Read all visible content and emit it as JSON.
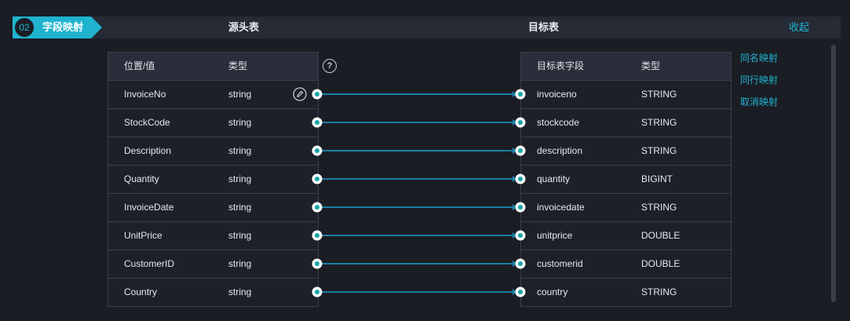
{
  "header": {
    "step_number": "02",
    "step_title": "字段映射",
    "source_title": "源头表",
    "target_title": "目标表",
    "collapse_label": "收起"
  },
  "source": {
    "columns": [
      "位置/值",
      "类型"
    ],
    "rows": [
      {
        "name": "InvoiceNo",
        "type": "string"
      },
      {
        "name": "StockCode",
        "type": "string"
      },
      {
        "name": "Description",
        "type": "string"
      },
      {
        "name": "Quantity",
        "type": "string"
      },
      {
        "name": "InvoiceDate",
        "type": "string"
      },
      {
        "name": "UnitPrice",
        "type": "string"
      },
      {
        "name": "CustomerID",
        "type": "string"
      },
      {
        "name": "Country",
        "type": "string"
      }
    ]
  },
  "target": {
    "columns": [
      "目标表字段",
      "类型"
    ],
    "rows": [
      {
        "name": "invoiceno",
        "type": "STRING"
      },
      {
        "name": "stockcode",
        "type": "STRING"
      },
      {
        "name": "description",
        "type": "STRING"
      },
      {
        "name": "quantity",
        "type": "BIGINT"
      },
      {
        "name": "invoicedate",
        "type": "STRING"
      },
      {
        "name": "unitprice",
        "type": "DOUBLE"
      },
      {
        "name": "customerid",
        "type": "DOUBLE"
      },
      {
        "name": "country",
        "type": "STRING"
      }
    ]
  },
  "help_icon": "?",
  "actions": [
    "同名映射",
    "同行映射",
    "取消映射"
  ],
  "colors": {
    "accent": "#1fb3cf",
    "link": "#1d7fa6",
    "background": "#1b1d25"
  },
  "icons": {
    "edit": "pencil-circle-icon",
    "help": "question-circle-icon"
  }
}
